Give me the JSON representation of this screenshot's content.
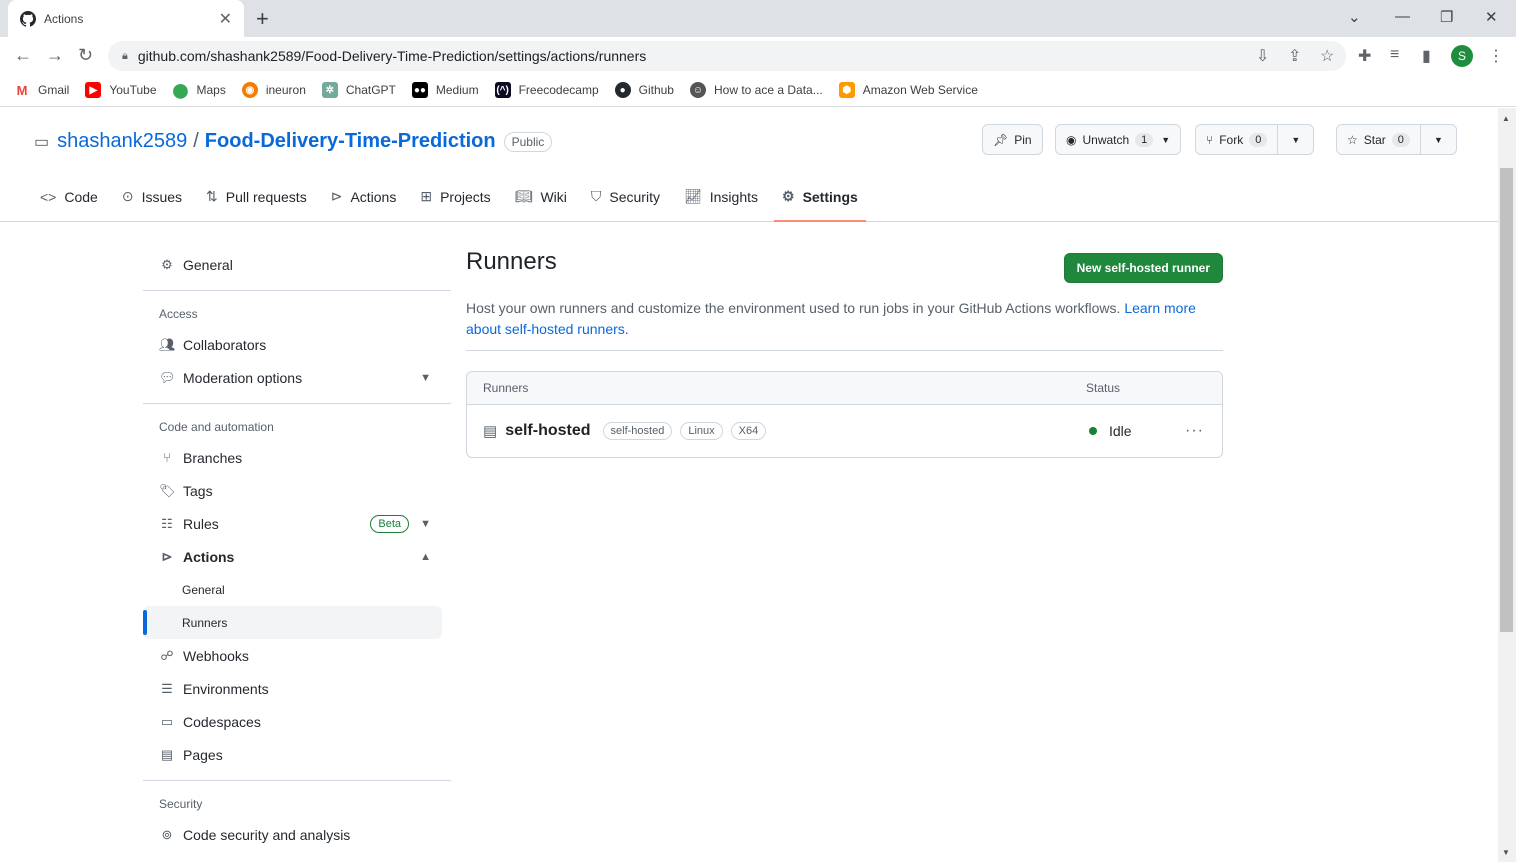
{
  "browser": {
    "tab_title": "Actions",
    "url": "github.com/shashank2589/Food-Delivery-Time-Prediction/settings/actions/runners",
    "profile_initial": "S",
    "bookmarks": [
      "Gmail",
      "YouTube",
      "Maps",
      "ineuron",
      "ChatGPT",
      "Medium",
      "Freecodecamp",
      "Github",
      "How to ace a Data...",
      "Amazon Web Service"
    ]
  },
  "repo": {
    "owner": "shashank2589",
    "separator": "/",
    "name": "Food-Delivery-Time-Prediction",
    "visibility": "Public",
    "pin_label": "Pin",
    "unwatch_label": "Unwatch",
    "watch_count": "1",
    "fork_label": "Fork",
    "fork_count": "0",
    "star_label": "Star",
    "star_count": "0"
  },
  "nav": {
    "code": "Code",
    "issues": "Issues",
    "pull_requests": "Pull requests",
    "actions": "Actions",
    "projects": "Projects",
    "wiki": "Wiki",
    "security": "Security",
    "insights": "Insights",
    "settings": "Settings"
  },
  "sidebar": {
    "general": "General",
    "access_heading": "Access",
    "collaborators": "Collaborators",
    "moderation": "Moderation options",
    "code_heading": "Code and automation",
    "branches": "Branches",
    "tags": "Tags",
    "rules": "Rules",
    "beta": "Beta",
    "actions": "Actions",
    "actions_general": "General",
    "actions_runners": "Runners",
    "webhooks": "Webhooks",
    "environments": "Environments",
    "codespaces": "Codespaces",
    "pages": "Pages",
    "security_heading": "Security",
    "code_security": "Code security and analysis"
  },
  "main": {
    "title": "Runners",
    "new_button": "New self-hosted runner",
    "description": "Host your own runners and customize the environment used to run jobs in your GitHub Actions workflows. ",
    "learn_more": "Learn more about self-hosted runners.",
    "table": {
      "col_runners": "Runners",
      "col_status": "Status",
      "runner_name": "self-hosted",
      "labels": [
        "self-hosted",
        "Linux",
        "X64"
      ],
      "status": "Idle"
    }
  },
  "colors": {
    "primary_button": "#1f883d",
    "link": "#0969da",
    "active_tab_underline": "#fd8c73",
    "idle_dot": "#1a7f37"
  }
}
